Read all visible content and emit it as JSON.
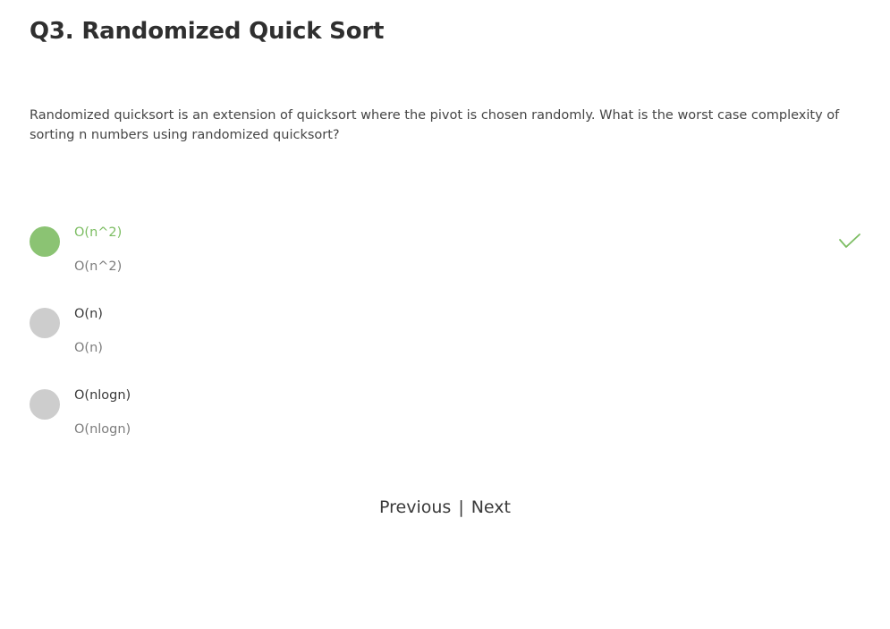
{
  "question": {
    "title": "Q3. Randomized Quick Sort",
    "text": "Randomized quicksort is an extension of quicksort where the pivot is chosen randomly. What is the worst case complexity of sorting n numbers using randomized quicksort?"
  },
  "options": [
    {
      "label": "O(n^2)",
      "sublabel": "O(n^2)",
      "selected": true,
      "correct": true,
      "status_icon": "check-icon"
    },
    {
      "label": "O(n)",
      "sublabel": "O(n)",
      "selected": false,
      "correct": false
    },
    {
      "label": "O(nlogn)",
      "sublabel": "O(nlogn)",
      "selected": false,
      "correct": false
    }
  ],
  "colors": {
    "correct_accent": "#7cbd62",
    "selected_radio": "#8bc373",
    "unselected_radio": "#cdcdcd"
  },
  "pager": {
    "previous_label": "Previous",
    "separator": "|",
    "next_label": "Next"
  }
}
